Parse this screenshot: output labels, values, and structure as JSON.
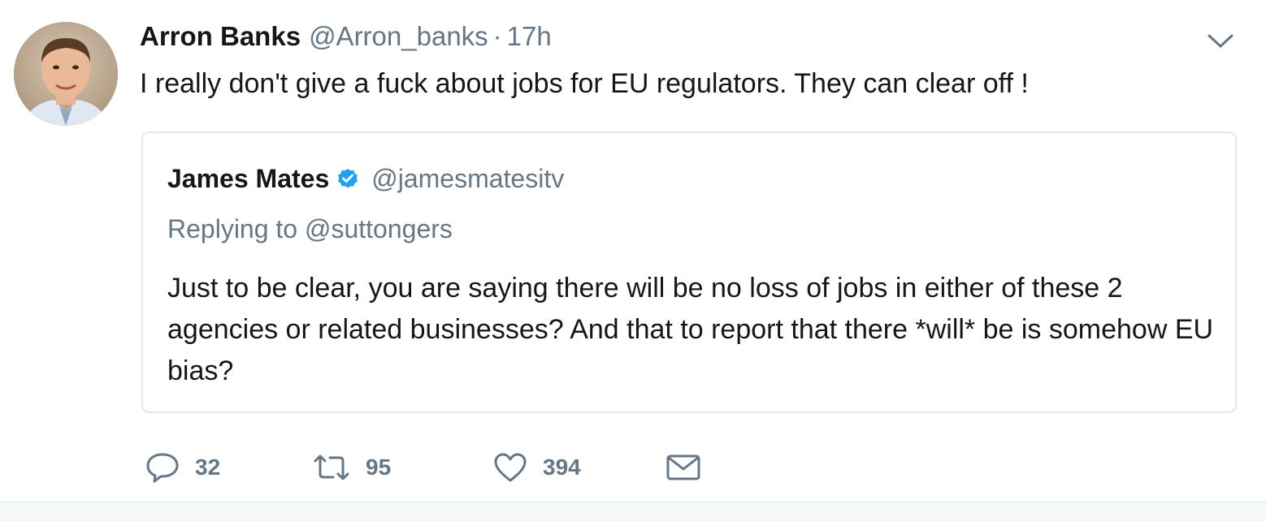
{
  "tweet": {
    "author_name": "Arron Banks",
    "author_handle": "@Arron_banks",
    "separator": "·",
    "time": "17h",
    "text": "I really don't give a fuck about jobs for EU regulators. They can clear off !",
    "avatar_icon": "user-photo-avatar",
    "more_icon": "chevron-down-icon"
  },
  "quoted": {
    "author_name": "James Mates",
    "verified_icon": "verified-badge-icon",
    "author_handle": "@jamesmatesitv",
    "reply_context": "Replying to @suttongers",
    "text": "Just to be clear, you are saying there will be no loss of jobs in either of these 2 agencies or related businesses? And that to report that there *will* be is somehow EU bias?"
  },
  "actions": {
    "reply": {
      "icon": "reply-icon",
      "count": "32"
    },
    "retweet": {
      "icon": "retweet-icon",
      "count": "95"
    },
    "like": {
      "icon": "heart-icon",
      "count": "394"
    },
    "message": {
      "icon": "envelope-icon"
    }
  },
  "colors": {
    "text_primary": "#14171a",
    "text_secondary": "#657786",
    "verified_blue": "#1da1f2",
    "border": "#e1e8ed"
  }
}
